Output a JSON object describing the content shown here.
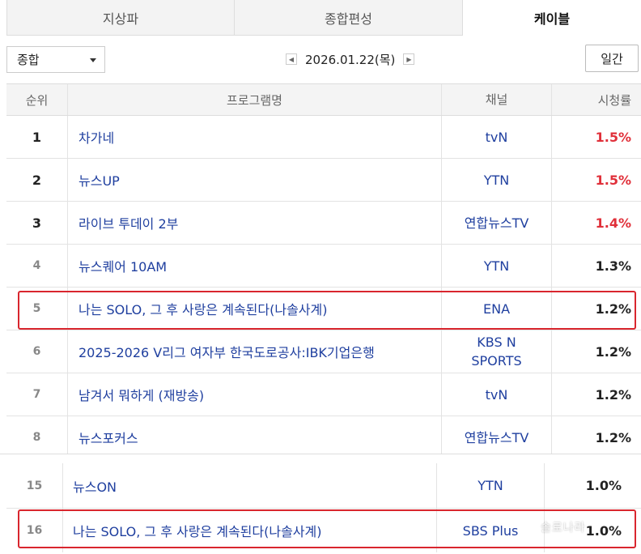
{
  "tabs": [
    {
      "label": "지상파"
    },
    {
      "label": "종합편성"
    },
    {
      "label": "케이블"
    }
  ],
  "controls": {
    "category": "종합",
    "date": "2026.01.22(목)",
    "period_button": "일간"
  },
  "table": {
    "headers": {
      "rank": "순위",
      "program": "프로그램명",
      "channel": "채널",
      "rating": "시청률"
    },
    "rows": [
      {
        "rank": "1",
        "program": "차가네",
        "channel": "tvN",
        "rating": "1.5%"
      },
      {
        "rank": "2",
        "program": "뉴스UP",
        "channel": "YTN",
        "rating": "1.5%"
      },
      {
        "rank": "3",
        "program": "라이브 투데이 2부",
        "channel": "연합뉴스TV",
        "rating": "1.4%"
      },
      {
        "rank": "4",
        "program": "뉴스퀘어 10AM",
        "channel": "YTN",
        "rating": "1.3%"
      },
      {
        "rank": "5",
        "program": "나는 SOLO, 그 후 사랑은 계속된다(나솔사계)",
        "channel": "ENA",
        "rating": "1.2%"
      },
      {
        "rank": "6",
        "program": "2025-2026 V리그 여자부 한국도로공사:IBK기업은행",
        "channel_line1": "KBS N",
        "channel_line2": "SPORTS",
        "rating": "1.2%"
      },
      {
        "rank": "7",
        "program": "남겨서 뭐하게 (재방송)",
        "channel": "tvN",
        "rating": "1.2%"
      },
      {
        "rank": "8",
        "program": "뉴스포커스",
        "channel": "연합뉴스TV",
        "rating": "1.2%"
      }
    ]
  },
  "table2": {
    "rows": [
      {
        "rank": "15",
        "program": "뉴스ON",
        "channel": "YTN",
        "rating": "1.0%"
      },
      {
        "rank": "16",
        "program": "나는 SOLO, 그 후 사랑은 계속된다(나솔사계)",
        "channel": "SBS Plus",
        "rating": "1.0%"
      }
    ]
  },
  "colors": {
    "highlight": "#d9262e",
    "rating_top": "#e0303a",
    "link": "#1f3f9f"
  },
  "watermark": "솔로나라"
}
